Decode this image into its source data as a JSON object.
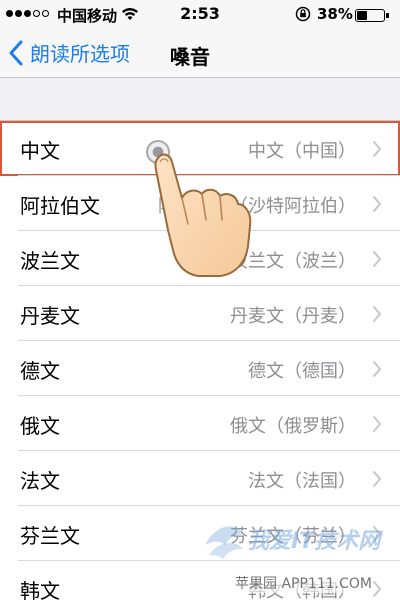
{
  "status_bar": {
    "carrier": "中国移动",
    "time": "2:53",
    "battery_percent": "38%",
    "battery_level": 0.38,
    "signal_icon": "signal-dots-icon",
    "wifi_icon": "wifi-icon",
    "lock_icon": "rotation-lock-icon"
  },
  "nav": {
    "back_label": "朗读所选项",
    "title": "嗓音"
  },
  "rows": [
    {
      "label": "中文",
      "value": "中文（中国）"
    },
    {
      "label": "阿拉伯文",
      "value": "阿拉伯文（沙特阿拉伯）"
    },
    {
      "label": "波兰文",
      "value": "波兰文（波兰）"
    },
    {
      "label": "丹麦文",
      "value": "丹麦文（丹麦）"
    },
    {
      "label": "德文",
      "value": "德文（德国）"
    },
    {
      "label": "俄文",
      "value": "俄文（俄罗斯）"
    },
    {
      "label": "法文",
      "value": "法文（法国）"
    },
    {
      "label": "芬兰文",
      "value": "芬兰文（芬兰）"
    },
    {
      "label": "韩文",
      "value": "韩文（韩国）"
    }
  ],
  "watermark": {
    "top_text": "我爱IT技术网",
    "bottom_text": "苹果园 APP111.COM"
  },
  "colors": {
    "ios_blue": "#1a7ef0",
    "highlight_border": "#d9573b",
    "secondary_text": "#8e8e93"
  }
}
